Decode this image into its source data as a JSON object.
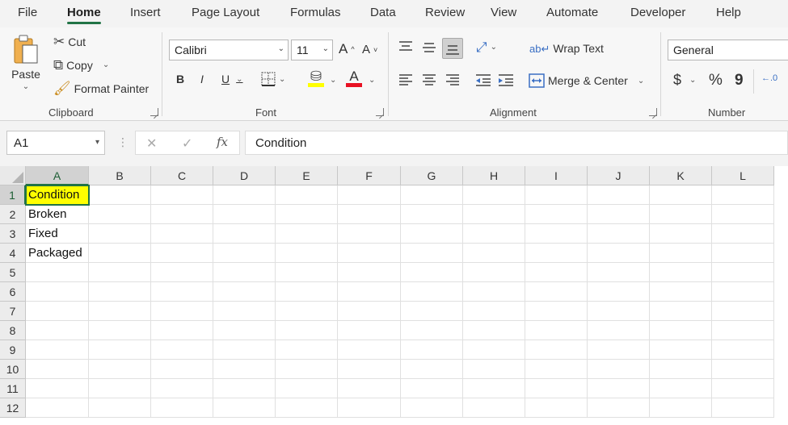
{
  "menu": {
    "tabs": [
      {
        "label": "File",
        "active": false
      },
      {
        "label": "Home",
        "active": true
      },
      {
        "label": "Insert",
        "active": false
      },
      {
        "label": "Page Layout",
        "active": false
      },
      {
        "label": "Formulas",
        "active": false
      },
      {
        "label": "Data",
        "active": false
      },
      {
        "label": "Review",
        "active": false
      },
      {
        "label": "View",
        "active": false
      },
      {
        "label": "Automate",
        "active": false
      },
      {
        "label": "Developer",
        "active": false
      },
      {
        "label": "Help",
        "active": false
      }
    ]
  },
  "ribbon": {
    "clipboard": {
      "group_label": "Clipboard",
      "paste_label": "Paste",
      "cut_label": "Cut",
      "copy_label": "Copy",
      "format_painter_label": "Format Painter"
    },
    "font": {
      "group_label": "Font",
      "font_name": "Calibri",
      "font_size": "11",
      "bold": "B",
      "italic": "I",
      "underline": "U",
      "font_color_glyph": "A",
      "grow_glyph": "A",
      "shrink_glyph": "A",
      "fill_color": "#ffff00",
      "font_color": "#e81123"
    },
    "alignment": {
      "group_label": "Alignment",
      "wrap_text_label": "Wrap Text",
      "merge_center_label": "Merge & Center"
    },
    "number": {
      "group_label": "Number",
      "format": "General",
      "currency": "$",
      "percent": "%",
      "comma": "9"
    }
  },
  "formula_bar": {
    "name_box": "A1",
    "fx_label": "fx",
    "content": "Condition"
  },
  "sheet": {
    "columns": [
      "A",
      "B",
      "C",
      "D",
      "E",
      "F",
      "G",
      "H",
      "I",
      "J",
      "K",
      "L"
    ],
    "rows": [
      "1",
      "2",
      "3",
      "4",
      "5",
      "6",
      "7",
      "8",
      "9",
      "10",
      "11",
      "12"
    ],
    "cells": [
      {
        "ref": "A1",
        "value": "Condition",
        "highlight": "#ffff00"
      },
      {
        "ref": "A2",
        "value": "Broken"
      },
      {
        "ref": "A3",
        "value": "Fixed"
      },
      {
        "ref": "A4",
        "value": "Packaged"
      }
    ],
    "selected": "A1",
    "accent": "#217346"
  }
}
